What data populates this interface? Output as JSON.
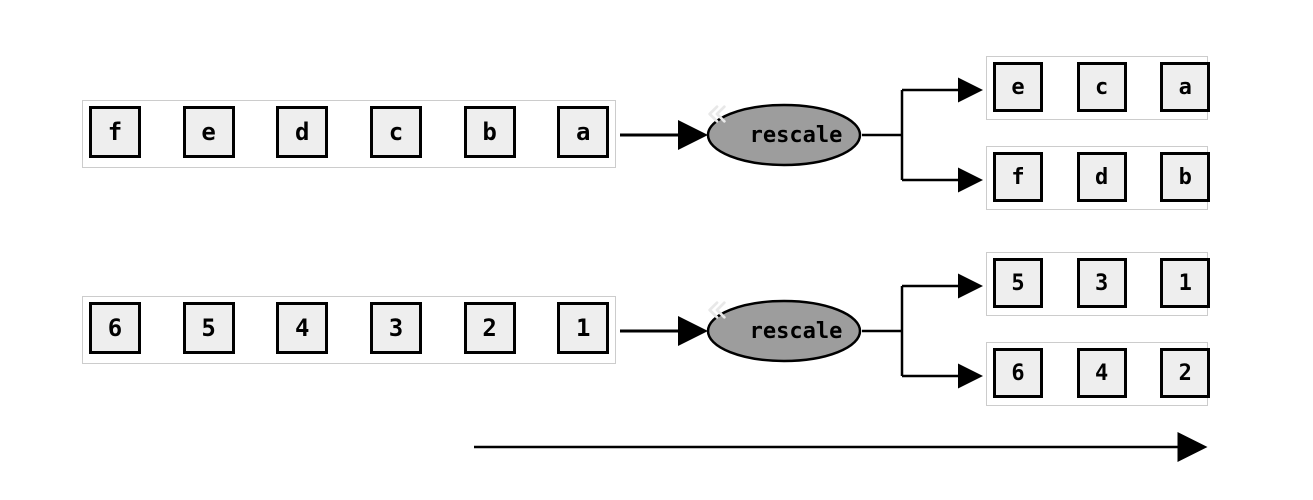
{
  "operator": {
    "label": "rescale",
    "icon": "rewind-icon"
  },
  "pipelines": [
    {
      "input": [
        "f",
        "e",
        "d",
        "c",
        "b",
        "a"
      ],
      "output": [
        [
          "e",
          "c",
          "a"
        ],
        [
          "f",
          "d",
          "b"
        ]
      ]
    },
    {
      "input": [
        "6",
        "5",
        "4",
        "3",
        "2",
        "1"
      ],
      "output": [
        [
          "5",
          "3",
          "1"
        ],
        [
          "6",
          "4",
          "2"
        ]
      ]
    }
  ]
}
